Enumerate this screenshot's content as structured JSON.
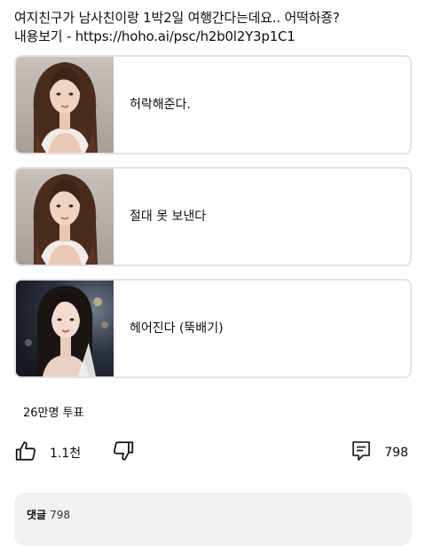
{
  "post": {
    "line1": "여지친구가 남사친이랑 1박2일 여행간다는데요..  어떡하죵?",
    "line2": "내용보기 - https://hoho.ai/psc/h2b0l2Y3p1C1"
  },
  "poll": {
    "options": [
      {
        "label": "허락해준다.",
        "image": "long-hair-woman-portrait"
      },
      {
        "label": "절대 못 보낸다",
        "image": "long-hair-woman-portrait"
      },
      {
        "label": "헤어진다 (뚝배기)",
        "image": "straight-hair-woman-night-portrait"
      }
    ],
    "vote_count": "26만명 투표"
  },
  "actions": {
    "like_icon": "thumbs-up-icon",
    "like_count": "1.1천",
    "dislike_icon": "thumbs-down-icon",
    "comment_icon": "comment-icon",
    "comment_count": "798"
  },
  "comments": {
    "title": "댓글",
    "count": "798"
  },
  "colors": {
    "text": "#0f0f0f",
    "border": "#e3e3e3",
    "comment_bg": "#f2f2f2"
  }
}
